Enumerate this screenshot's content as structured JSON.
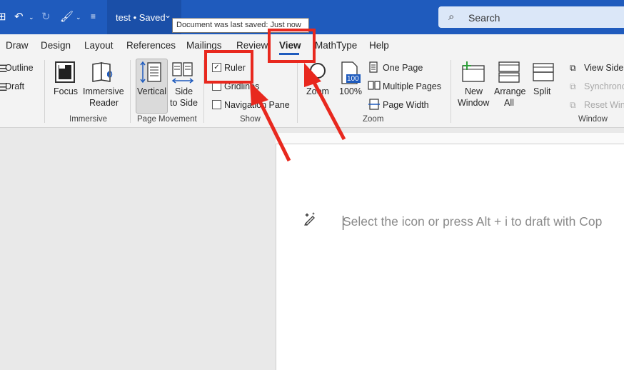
{
  "titlebar": {
    "doc_title": "test • Saved",
    "tooltip": "Document was last saved: Just now",
    "search_placeholder": "Search"
  },
  "tabs": [
    "Draw",
    "Design",
    "Layout",
    "References",
    "Mailings",
    "Review",
    "View",
    "MathType",
    "Help"
  ],
  "active_tab": "View",
  "ribbon": {
    "views": {
      "outline": "Outline",
      "draft": "Draft"
    },
    "immersive": {
      "focus": "Focus",
      "immersive_reader_1": "Immersive",
      "immersive_reader_2": "Reader",
      "label": "Immersive"
    },
    "page_movement": {
      "vertical": "Vertical",
      "side_1": "Side",
      "side_2": "to Side",
      "label": "Page Movement"
    },
    "show": {
      "ruler": "Ruler",
      "gridlines": "Gridlines",
      "navigation_pane": "Navigation Pane",
      "label": "Show",
      "ruler_checked": true
    },
    "zoom": {
      "zoom": "Zoom",
      "hundred": "100%",
      "hundred_badge": "100",
      "one_page": "One Page",
      "multiple_pages": "Multiple Pages",
      "page_width": "Page Width",
      "label": "Zoom"
    },
    "window": {
      "new_1": "New",
      "new_2": "Window",
      "arrange_1": "Arrange",
      "arrange_2": "All",
      "split": "Split",
      "view_side": "View Side b",
      "synchronous": "Synchronou",
      "reset_window": "Reset Wind",
      "label": "Window"
    }
  },
  "document": {
    "placeholder": "Select the icon or press Alt + i to draft with Cop"
  },
  "colors": {
    "titlebar": "#1f5bbd",
    "annotation": "#e8281e"
  }
}
